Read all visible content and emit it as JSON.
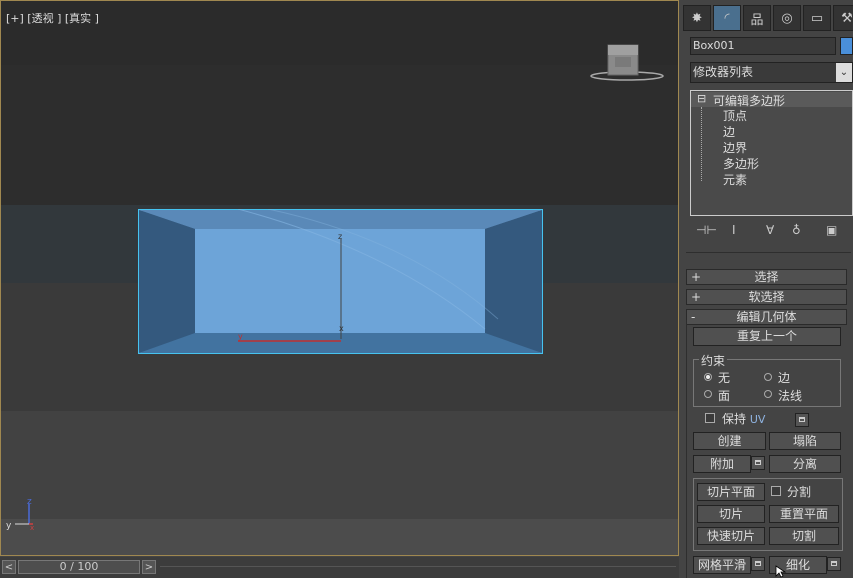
{
  "viewport": {
    "label": "[+] [透视 ] [真实 ]",
    "axis": {
      "x": "x",
      "y": "y",
      "z": "z"
    },
    "gizmo_axis": {
      "z": "z",
      "x": "x",
      "y": "y"
    }
  },
  "timeline": {
    "prev": "<",
    "next": ">",
    "frame_readout": "0 / 100"
  },
  "panel": {
    "tabs": [
      {
        "icon": "create-icon",
        "glyph": "✸"
      },
      {
        "icon": "modify-icon",
        "glyph": "◜"
      },
      {
        "icon": "hierarchy-icon",
        "glyph": "品"
      },
      {
        "icon": "motion-icon",
        "glyph": "◎"
      },
      {
        "icon": "display-icon",
        "glyph": "▭"
      },
      {
        "icon": "utilities-icon",
        "glyph": "⚒"
      }
    ],
    "object_name": "Box001",
    "object_color": "#4a8fd9",
    "modifier_list": "修改器列表",
    "stack": {
      "root": "可编辑多边形",
      "root_toggle": "⊟",
      "items": [
        "顶点",
        "边",
        "边界",
        "多边形",
        "元素"
      ]
    },
    "stack_tools": [
      "pin-stack-icon",
      "show-end-result-icon",
      "make-unique-icon",
      "remove-modifier-icon",
      "configure-sets-icon"
    ],
    "rollouts": {
      "select": {
        "sign": "+",
        "label": "选择"
      },
      "soft": {
        "sign": "+",
        "label": "软选择"
      },
      "edit_geometry": {
        "sign": "-",
        "label": "编辑几何体"
      }
    },
    "repeat_last": "重复上一个",
    "constraints": {
      "title": "约束",
      "options": [
        "无",
        "边",
        "面",
        "法线"
      ],
      "selected": "无"
    },
    "preserve_uv": {
      "label": "保持",
      "suffix": "UV"
    },
    "buttons": {
      "create": "创建",
      "collapse": "塌陷",
      "attach": "附加",
      "detach": "分离",
      "slice_plane": "切片平面",
      "split": "分割",
      "slice": "切片",
      "reset_plane": "重置平面",
      "quick_slice": "快速切片",
      "cut": "切割",
      "mesh_smooth": "网格平滑",
      "tessellate": "细化"
    },
    "accent": "#4a6f8e"
  }
}
